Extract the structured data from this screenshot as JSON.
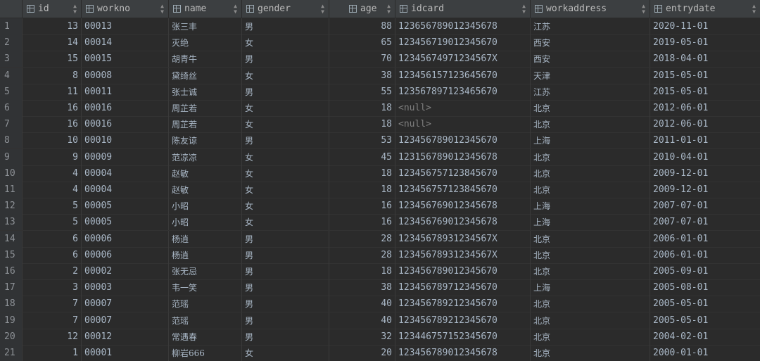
{
  "table": {
    "columns": [
      {
        "key": "id",
        "label": "id"
      },
      {
        "key": "workno",
        "label": "workno"
      },
      {
        "key": "name",
        "label": "name"
      },
      {
        "key": "gender",
        "label": "gender"
      },
      {
        "key": "age",
        "label": "age"
      },
      {
        "key": "idcard",
        "label": "idcard"
      },
      {
        "key": "workaddress",
        "label": "workaddress"
      },
      {
        "key": "entrydate",
        "label": "entrydate"
      }
    ],
    "icons": {
      "column": "table-column-icon",
      "sort": "sort-icon"
    },
    "rows": [
      {
        "n": "1",
        "id": "13",
        "workno": "00013",
        "name": "张三丰",
        "gender": "男",
        "age": "88",
        "idcard": "123656789012345678",
        "workaddress": "江苏",
        "entrydate": "2020-11-01"
      },
      {
        "n": "2",
        "id": "14",
        "workno": "00014",
        "name": "灭绝",
        "gender": "女",
        "age": "65",
        "idcard": "123456719012345670",
        "workaddress": "西安",
        "entrydate": "2019-05-01"
      },
      {
        "n": "3",
        "id": "15",
        "workno": "00015",
        "name": "胡青牛",
        "gender": "男",
        "age": "70",
        "idcard": "12345674971234567X",
        "workaddress": "西安",
        "entrydate": "2018-04-01"
      },
      {
        "n": "4",
        "id": "8",
        "workno": "00008",
        "name": "黛绮丝",
        "gender": "女",
        "age": "38",
        "idcard": "123456157123645670",
        "workaddress": "天津",
        "entrydate": "2015-05-01"
      },
      {
        "n": "5",
        "id": "11",
        "workno": "00011",
        "name": "张士诚",
        "gender": "男",
        "age": "55",
        "idcard": "123567897123465670",
        "workaddress": "江苏",
        "entrydate": "2015-05-01"
      },
      {
        "n": "6",
        "id": "16",
        "workno": "00016",
        "name": "周芷若",
        "gender": "女",
        "age": "18",
        "idcard": "<null>",
        "workaddress": "北京",
        "entrydate": "2012-06-01"
      },
      {
        "n": "7",
        "id": "16",
        "workno": "00016",
        "name": "周芷若",
        "gender": "女",
        "age": "18",
        "idcard": "<null>",
        "workaddress": "北京",
        "entrydate": "2012-06-01"
      },
      {
        "n": "8",
        "id": "10",
        "workno": "00010",
        "name": "陈友谅",
        "gender": "男",
        "age": "53",
        "idcard": "123456789012345670",
        "workaddress": "上海",
        "entrydate": "2011-01-01"
      },
      {
        "n": "9",
        "id": "9",
        "workno": "00009",
        "name": "范凉凉",
        "gender": "女",
        "age": "45",
        "idcard": "123156789012345678",
        "workaddress": "北京",
        "entrydate": "2010-04-01"
      },
      {
        "n": "10",
        "id": "4",
        "workno": "00004",
        "name": "赵敏",
        "gender": "女",
        "age": "18",
        "idcard": "123456757123845670",
        "workaddress": "北京",
        "entrydate": "2009-12-01"
      },
      {
        "n": "11",
        "id": "4",
        "workno": "00004",
        "name": "赵敏",
        "gender": "女",
        "age": "18",
        "idcard": "123456757123845670",
        "workaddress": "北京",
        "entrydate": "2009-12-01"
      },
      {
        "n": "12",
        "id": "5",
        "workno": "00005",
        "name": "小昭",
        "gender": "女",
        "age": "16",
        "idcard": "123456769012345678",
        "workaddress": "上海",
        "entrydate": "2007-07-01"
      },
      {
        "n": "13",
        "id": "5",
        "workno": "00005",
        "name": "小昭",
        "gender": "女",
        "age": "16",
        "idcard": "123456769012345678",
        "workaddress": "上海",
        "entrydate": "2007-07-01"
      },
      {
        "n": "14",
        "id": "6",
        "workno": "00006",
        "name": "杨逍",
        "gender": "男",
        "age": "28",
        "idcard": "12345678931234567X",
        "workaddress": "北京",
        "entrydate": "2006-01-01"
      },
      {
        "n": "15",
        "id": "6",
        "workno": "00006",
        "name": "杨逍",
        "gender": "男",
        "age": "28",
        "idcard": "12345678931234567X",
        "workaddress": "北京",
        "entrydate": "2006-01-01"
      },
      {
        "n": "16",
        "id": "2",
        "workno": "00002",
        "name": "张无忌",
        "gender": "男",
        "age": "18",
        "idcard": "123456789012345670",
        "workaddress": "北京",
        "entrydate": "2005-09-01"
      },
      {
        "n": "17",
        "id": "3",
        "workno": "00003",
        "name": "韦一笑",
        "gender": "男",
        "age": "38",
        "idcard": "123456789712345670",
        "workaddress": "上海",
        "entrydate": "2005-08-01"
      },
      {
        "n": "18",
        "id": "7",
        "workno": "00007",
        "name": "范瑶",
        "gender": "男",
        "age": "40",
        "idcard": "123456789212345670",
        "workaddress": "北京",
        "entrydate": "2005-05-01"
      },
      {
        "n": "19",
        "id": "7",
        "workno": "00007",
        "name": "范瑶",
        "gender": "男",
        "age": "40",
        "idcard": "123456789212345670",
        "workaddress": "北京",
        "entrydate": "2005-05-01"
      },
      {
        "n": "20",
        "id": "12",
        "workno": "00012",
        "name": "常遇春",
        "gender": "男",
        "age": "32",
        "idcard": "123446757152345670",
        "workaddress": "北京",
        "entrydate": "2004-02-01"
      },
      {
        "n": "21",
        "id": "1",
        "workno": "00001",
        "name": "柳岩666",
        "gender": "女",
        "age": "20",
        "idcard": "123456789012345678",
        "workaddress": "北京",
        "entrydate": "2000-01-01"
      }
    ]
  },
  "colors": {
    "background": "#2b2b2b",
    "header": "#3c3f41",
    "text": "#a9b7c6",
    "null_text": "#7f7f7f"
  }
}
